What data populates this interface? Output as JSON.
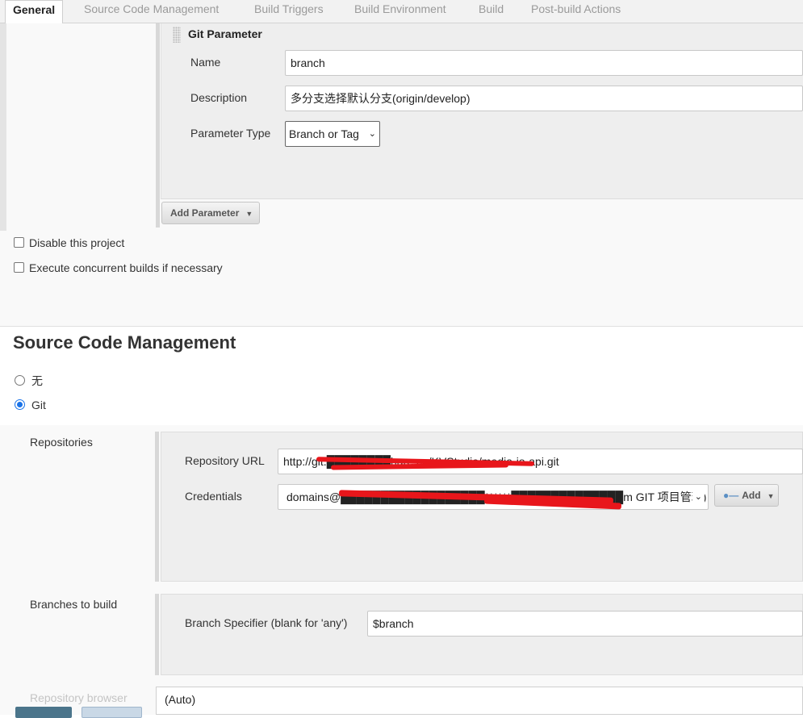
{
  "tabs": [
    {
      "label": "General"
    },
    {
      "label": "Source Code Management"
    },
    {
      "label": "Build Triggers"
    },
    {
      "label": "Build Environment"
    },
    {
      "label": "Build"
    },
    {
      "label": "Post-build Actions"
    }
  ],
  "git_parameter": {
    "title": "Git Parameter",
    "name_label": "Name",
    "name_value": "branch",
    "description_label": "Description",
    "description_value": "多分支选择默认分支(origin/develop)",
    "type_label": "Parameter Type",
    "type_value": "Branch or Tag"
  },
  "add_parameter_label": "Add Parameter",
  "options": {
    "disable_project": "Disable this project",
    "concurrent_builds": "Execute concurrent builds if necessary"
  },
  "scm": {
    "title": "Source Code Management",
    "none_label": "无",
    "git_label": "Git",
    "repositories_label": "Repositories",
    "repository_url_label": "Repository URL",
    "repository_url_value": "http://git.████████hare.cn/KVStudio/media-io-api.git",
    "credentials_label": "Credentials",
    "credentials_value": "domains@██████████████████******██████████████m GIT 项目管理)",
    "credentials_add_label": "Add",
    "branches_label": "Branches to build",
    "branch_specifier_label": "Branch Specifier (blank for 'any')",
    "branch_specifier_value": "$branch",
    "repo_browser_label": "Repository browser",
    "repo_browser_value": "(Auto)"
  },
  "colors": {
    "accent": "#1a73e8",
    "redaction": "#e8161b",
    "save_button": "#4b758b",
    "apply_button": "#c9d8e6"
  }
}
